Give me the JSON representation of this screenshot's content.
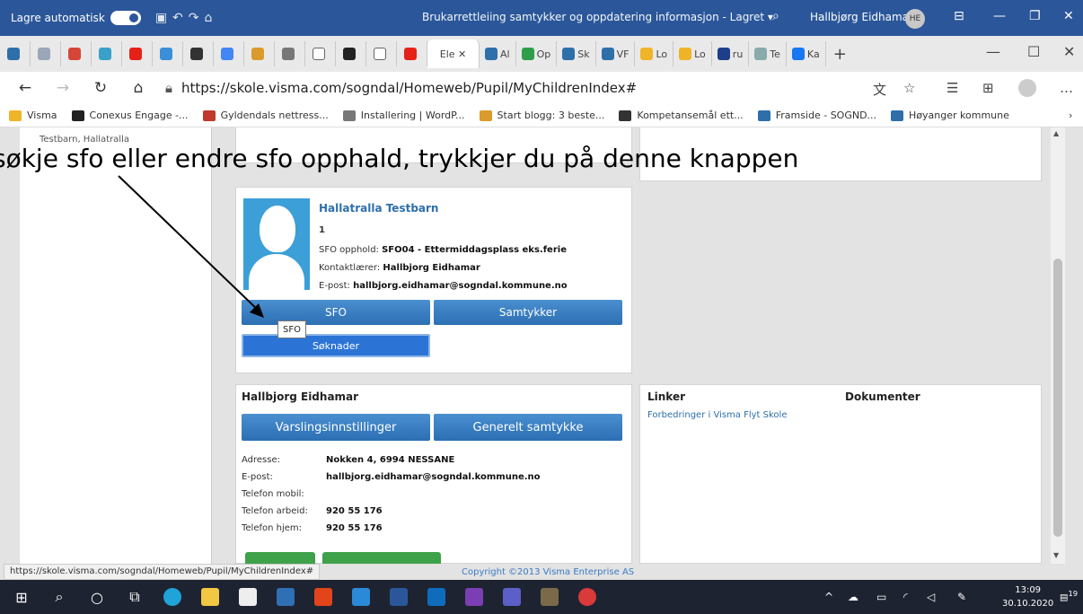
{
  "office": {
    "autosave_label": "Lagre automatisk",
    "doc_title": "Brukarrettleiing samtykker og oppdatering informasjon - Lagret ▾",
    "user_name": "Hallbjørg Eidhamar",
    "user_initials": "HE"
  },
  "browser": {
    "active_tab": "Ele",
    "tabs": [
      "Al",
      "Op",
      "Sk",
      "VF",
      "Lo",
      "Lo",
      "ru",
      "Te",
      "Ka"
    ],
    "url": "https://skole.visma.com/sogndal/Homeweb/Pupil/MyChildrenIndex#",
    "bookmarks": [
      {
        "label": "Visma",
        "color": "#f0b429"
      },
      {
        "label": "Conexus Engage -...",
        "color": "#222222"
      },
      {
        "label": "Gyldendals nettress...",
        "color": "#c0392b"
      },
      {
        "label": "Installering | WordP...",
        "color": "#777777"
      },
      {
        "label": "Start blogg: 3 beste...",
        "color": "#d99b2b"
      },
      {
        "label": "Kompetansemål ett...",
        "color": "#333333"
      },
      {
        "label": "Framside - SOGND...",
        "color": "#2e6faa"
      },
      {
        "label": "Høyanger kommune",
        "color": "#2e6faa"
      }
    ]
  },
  "page": {
    "breadcrumb": "Testbarn, Hallatralla",
    "annotation": "søkje sfo eller endre sfo opphald, trykkjer du på denne knappen",
    "child": {
      "name": "Hallatralla Testbarn",
      "grade": "1",
      "sfo_label": "SFO opphold:",
      "sfo_value": "SFO04 - Ettermiddagsplass eks.ferie",
      "teacher_label": "Kontaktlærer:",
      "teacher_value": "Hallbjorg Eidhamar",
      "email_label": "E-post:",
      "email_value": "hallbjorg.eidhamar@sogndal.kommune.no",
      "btn_sfo": "SFO",
      "btn_samtykker": "Samtykker",
      "tooltip": "SFO",
      "btn_soknader": "Søknader"
    },
    "parent": {
      "name": "Hallbjorg Eidhamar",
      "btn_varsling": "Varslingsinnstillinger",
      "btn_samtykke": "Generelt samtykke",
      "rows": [
        {
          "label": "Adresse:",
          "value": "Nokken 4, 6994 NESSANE"
        },
        {
          "label": "E-post:",
          "value": "hallbjorg.eidhamar@sogndal.kommune.no"
        },
        {
          "label": "Telefon mobil:",
          "value": ""
        },
        {
          "label": "Telefon arbeid:",
          "value": "920 55 176"
        },
        {
          "label": "Telefon hjem:",
          "value": "920 55 176"
        }
      ]
    },
    "links": {
      "heading": "Linker",
      "docs_heading": "Dokumenter",
      "link1": "Forbedringer i Visma Flyt Skole"
    },
    "status_url": "https://skole.visma.com/sogndal/Homeweb/Pupil/MyChildrenIndex#",
    "copyright": "Copyright ©2013 Visma Enterprise AS"
  },
  "taskbar": {
    "time": "13:09",
    "date": "30.10.2020",
    "notifications": "19"
  }
}
